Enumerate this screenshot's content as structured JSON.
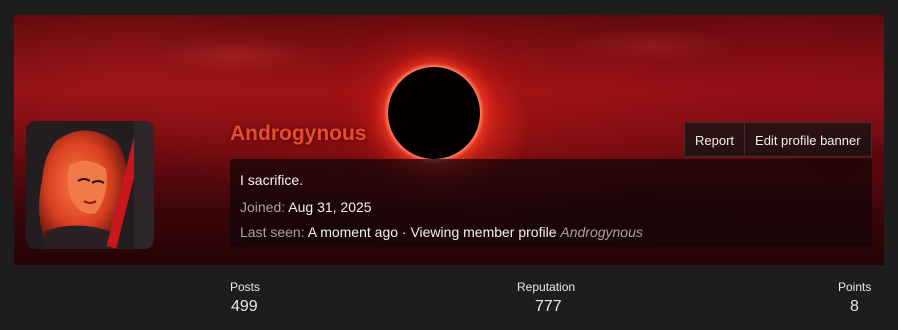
{
  "profile": {
    "username": "Androgynous",
    "status": "I sacrifice.",
    "joined_label": "Joined:",
    "joined_value": "Aug 31, 2025",
    "last_seen_label": "Last seen:",
    "last_seen_value": "A moment ago · Viewing member profile",
    "last_seen_target": "Androgynous"
  },
  "actions": {
    "report": "Report",
    "edit_banner": "Edit profile banner"
  },
  "stats": {
    "posts_label": "Posts",
    "posts_value": "499",
    "reputation_label": "Reputation",
    "reputation_value": "777",
    "points_label": "Points",
    "points_value": "8"
  },
  "colors": {
    "username": "#ee4a2a",
    "page_bg": "#1d1d1d"
  }
}
